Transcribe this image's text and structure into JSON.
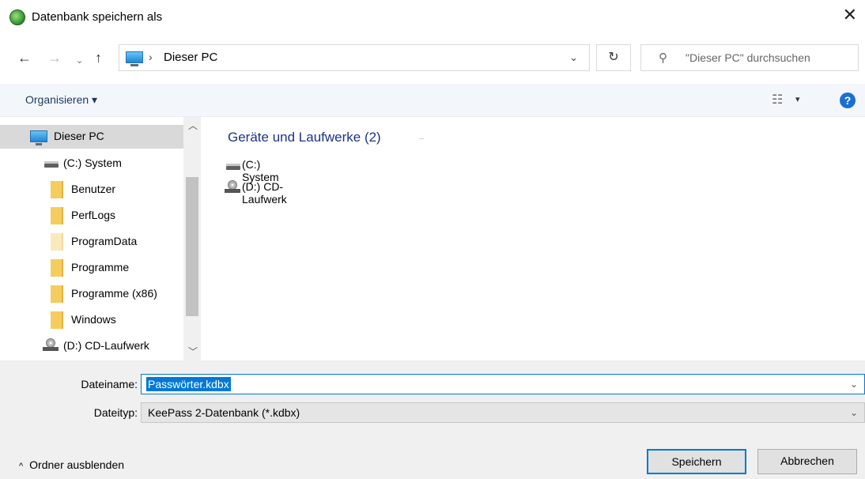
{
  "window": {
    "title": "Datenbank speichern als",
    "app_icon": "keepass-icon",
    "close_glyph": "✕"
  },
  "navigation": {
    "back_glyph": "←",
    "forward_glyph": "→",
    "recent_glyph": "⌄",
    "up_glyph": "↑",
    "address_separator": "›",
    "address_path": "Dieser PC",
    "address_dropdown_glyph": "⌄",
    "refresh_glyph": "↻",
    "search_placeholder": "\"Dieser PC\" durchsuchen"
  },
  "toolbar": {
    "organize_label": "Organisieren ▾",
    "view_icon": "view-options-icon",
    "view_dropdown_glyph": "▾",
    "help_glyph": "?"
  },
  "tree": {
    "items": [
      {
        "label": "Dieser PC",
        "icon": "this-pc-icon",
        "selected": true
      },
      {
        "label": "(C:) System",
        "icon": "hard-drive-icon"
      },
      {
        "label": "Benutzer",
        "icon": "folder-icon"
      },
      {
        "label": "PerfLogs",
        "icon": "folder-icon"
      },
      {
        "label": "ProgramData",
        "icon": "folder-hidden-icon"
      },
      {
        "label": "Programme",
        "icon": "folder-icon"
      },
      {
        "label": "Programme (x86)",
        "icon": "folder-icon"
      },
      {
        "label": "Windows",
        "icon": "folder-icon"
      },
      {
        "label": "(D:) CD-Laufwerk",
        "icon": "cd-drive-icon"
      }
    ]
  },
  "content": {
    "group_title": "Geräte und Laufwerke (2)",
    "items": [
      {
        "label": "(C:) System",
        "icon": "hard-drive-icon"
      },
      {
        "label": "(D:) CD-Laufwerk",
        "icon": "cd-drive-icon"
      }
    ]
  },
  "form": {
    "filename_label": "Dateiname:",
    "filename_value": "Passwörter.kdbx",
    "filetype_label": "Dateityp:",
    "filetype_value": "KeePass 2-Datenbank (*.kdbx)",
    "dropdown_glyph": "⌄"
  },
  "footer": {
    "hide_folders_caret": "^",
    "hide_folders_label": "Ordner ausblenden",
    "save_label": "Speichern",
    "cancel_label": "Abbrechen"
  },
  "colors": {
    "accent": "#0078d7",
    "group_title": "#1e3287",
    "toolbar_bg": "#f3f6fb",
    "selected_bg": "#d9d9d9"
  }
}
